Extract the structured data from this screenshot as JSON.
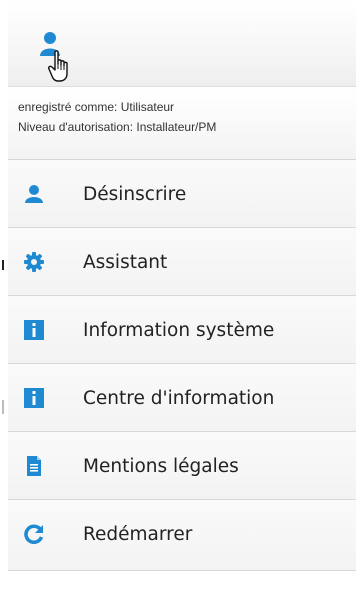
{
  "session": {
    "registered_as": "enregistré comme: Utilisateur",
    "authorization_level": "Niveau d'autorisation: Installateur/PM"
  },
  "menu": {
    "items": [
      {
        "label": "Désinscrire",
        "icon": "user-icon"
      },
      {
        "label": "Assistant",
        "icon": "gear-icon"
      },
      {
        "label": "Information système",
        "icon": "info-icon"
      },
      {
        "label": "Centre d'information",
        "icon": "info-icon"
      },
      {
        "label": "Mentions légales",
        "icon": "document-icon"
      },
      {
        "label": "Redémarrer",
        "icon": "refresh-icon"
      }
    ]
  },
  "colors": {
    "accent": "#1f8ad1",
    "text": "#222222",
    "background": "#f4f4f4",
    "divider": "#d9d9d9"
  }
}
